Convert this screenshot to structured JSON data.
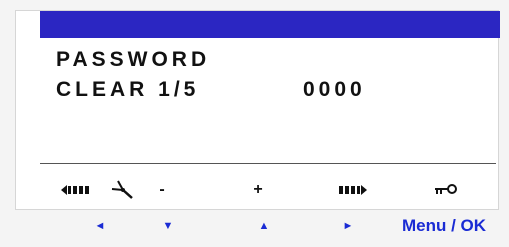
{
  "display": {
    "line1": "PASSWORD",
    "line2": "CLEAR 1/5",
    "code": "0000"
  },
  "icons": {
    "move_left": "move-left-icon",
    "ladder": "ladder-icon",
    "minus": "-",
    "plus": "+",
    "move_right": "move-right-icon",
    "key": "key-icon"
  },
  "nav": {
    "left": "◄",
    "down": "▼",
    "up": "▲",
    "right": "►",
    "menu_ok": "Menu / OK"
  },
  "colors": {
    "title_bar": "#2b26c2",
    "nav_text": "#1a2bd4",
    "lcd_bg": "#ffffff"
  }
}
